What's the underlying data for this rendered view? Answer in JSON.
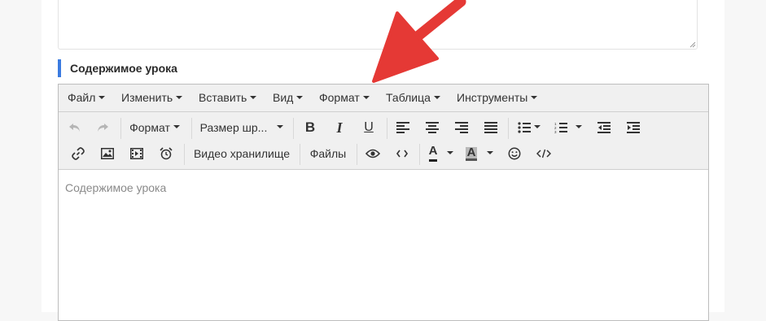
{
  "field": {
    "label": "Содержимое урока"
  },
  "menu": [
    {
      "label": "Файл"
    },
    {
      "label": "Изменить"
    },
    {
      "label": "Вставить"
    },
    {
      "label": "Вид"
    },
    {
      "label": "Формат"
    },
    {
      "label": "Таблица"
    },
    {
      "label": "Инструменты"
    }
  ],
  "toolbar": {
    "format_label": "Формат",
    "font_size_label": "Размер шр...",
    "bold_glyph": "B",
    "italic_glyph": "I",
    "underline_glyph": "U",
    "video_storage_label": "Видео хранилище",
    "files_label": "Файлы",
    "text_color_glyph": "A",
    "bg_color_glyph": "A"
  },
  "editor": {
    "placeholder": "Содержимое урока"
  },
  "colors": {
    "accent": "#3b7be0",
    "arrow": "#e53935"
  },
  "icons": [
    "undo-icon",
    "redo-icon",
    "link-icon",
    "image-icon",
    "media-icon",
    "alarm-clock-icon",
    "eye-icon",
    "code-icon",
    "emoticon-icon",
    "source-code-icon"
  ]
}
